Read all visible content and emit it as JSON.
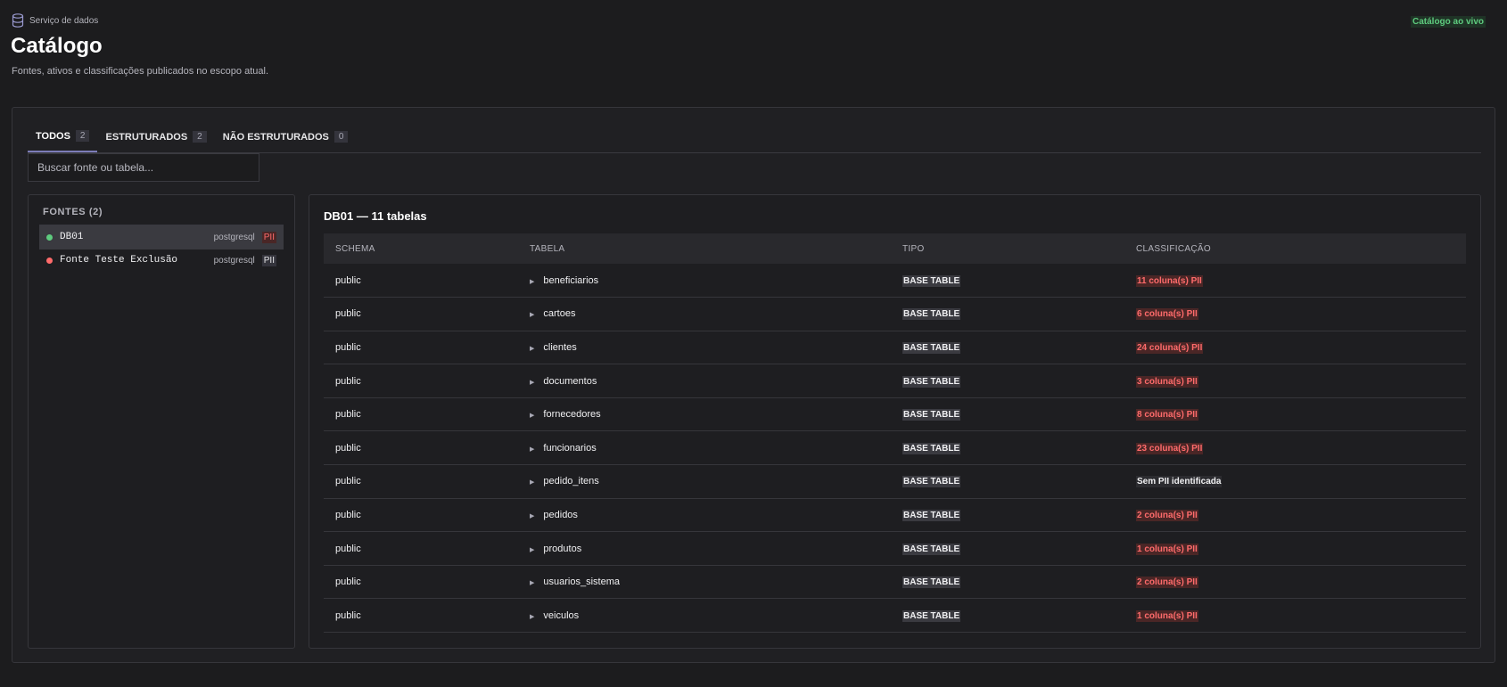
{
  "header": {
    "breadcrumb": "Serviço de dados",
    "title": "Catálogo",
    "subtitle": "Fontes, ativos e classificações publicados no escopo atual.",
    "live_status": "Catálogo ao vivo",
    "live_color": "#5ecb7e"
  },
  "tabs": [
    {
      "label": "TODOS",
      "count": "2"
    },
    {
      "label": "ESTRUTURADOS",
      "count": "2"
    },
    {
      "label": "NÃO ESTRUTURADOS",
      "count": "0"
    }
  ],
  "search": {
    "placeholder": "Buscar fonte ou tabela..."
  },
  "sources": {
    "title": "FONTES (2)",
    "items": [
      {
        "name": "DB01",
        "engine": "postgresql",
        "badge": "PII",
        "status_color": "#5ecb7e"
      },
      {
        "name": "Fonte Teste Exclusão",
        "engine": "postgresql",
        "badge": "PII",
        "status_color": "#ff6b6b"
      }
    ]
  },
  "detail": {
    "title": "DB01 — 11 tabelas",
    "columns": [
      "SCHEMA",
      "TABELA",
      "TIPO",
      "CLASSIFICAÇÃO"
    ],
    "rows": [
      {
        "schema": "public",
        "table": "beneficiarios",
        "type": "BASE TABLE",
        "classification": "11 coluna(s) PII"
      },
      {
        "schema": "public",
        "table": "cartoes",
        "type": "BASE TABLE",
        "classification": "6 coluna(s) PII"
      },
      {
        "schema": "public",
        "table": "clientes",
        "type": "BASE TABLE",
        "classification": "24 coluna(s) PII"
      },
      {
        "schema": "public",
        "table": "documentos",
        "type": "BASE TABLE",
        "classification": "3 coluna(s) PII"
      },
      {
        "schema": "public",
        "table": "fornecedores",
        "type": "BASE TABLE",
        "classification": "8 coluna(s) PII"
      },
      {
        "schema": "public",
        "table": "funcionarios",
        "type": "BASE TABLE",
        "classification": "23 coluna(s) PII"
      },
      {
        "schema": "public",
        "table": "pedido_itens",
        "type": "BASE TABLE",
        "classification": "Sem PII identificada"
      },
      {
        "schema": "public",
        "table": "pedidos",
        "type": "BASE TABLE",
        "classification": "2 coluna(s) PII"
      },
      {
        "schema": "public",
        "table": "produtos",
        "type": "BASE TABLE",
        "classification": "1 coluna(s) PII"
      },
      {
        "schema": "public",
        "table": "usuarios_sistema",
        "type": "BASE TABLE",
        "classification": "2 coluna(s) PII"
      },
      {
        "schema": "public",
        "table": "veiculos",
        "type": "BASE TABLE",
        "classification": "1 coluna(s) PII"
      }
    ]
  }
}
